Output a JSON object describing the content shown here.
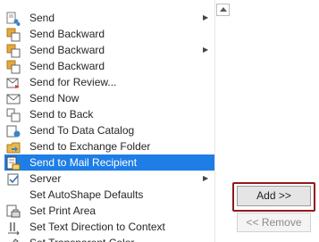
{
  "commands": [
    {
      "label": "Send",
      "icon": "send-icon",
      "submenu": true
    },
    {
      "label": "Send Backward",
      "icon": "send-backward-icon",
      "submenu": false
    },
    {
      "label": "Send Backward",
      "icon": "send-backward-icon",
      "submenu": true
    },
    {
      "label": "Send Backward",
      "icon": "send-backward-icon",
      "submenu": false
    },
    {
      "label": "Send for Review...",
      "icon": "send-for-review-icon",
      "submenu": false
    },
    {
      "label": "Send Now",
      "icon": "send-now-icon",
      "submenu": false
    },
    {
      "label": "Send to Back",
      "icon": "send-to-back-icon",
      "submenu": false
    },
    {
      "label": "Send To Data Catalog",
      "icon": "data-catalog-icon",
      "submenu": false
    },
    {
      "label": "Send to Exchange Folder",
      "icon": "exchange-folder-icon",
      "submenu": false
    },
    {
      "label": "Send to Mail Recipient",
      "icon": "mail-recipient-icon",
      "submenu": false,
      "selected": true
    },
    {
      "label": "Server",
      "icon": "server-icon",
      "submenu": true
    },
    {
      "label": "Set AutoShape Defaults",
      "icon": "",
      "submenu": false
    },
    {
      "label": "Set Print Area",
      "icon": "print-area-icon",
      "submenu": false
    },
    {
      "label": "Set Text Direction to Context",
      "icon": "text-direction-icon",
      "submenu": false
    },
    {
      "label": "Set Transparent Color",
      "icon": "transparent-color-icon",
      "submenu": false
    }
  ],
  "buttons": {
    "add_label": "Add >>",
    "remove_label": "<< Remove"
  },
  "colors": {
    "selection": "#1e7ee6",
    "focus_frame": "#8f1a1a"
  }
}
